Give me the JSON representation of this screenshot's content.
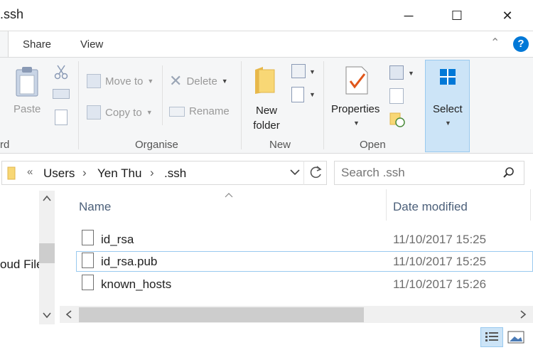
{
  "window": {
    "title": ".ssh",
    "minimize_glyph": "─",
    "maximize_glyph": "☐",
    "close_glyph": "✕"
  },
  "ribbon_tabs": {
    "share": "Share",
    "view": "View"
  },
  "help_glyph": "?",
  "collapse_glyph": "⌃",
  "ribbon": {
    "clipboard": {
      "paste": "Paste",
      "group_label_partial": "rd"
    },
    "organise": {
      "label": "Organise",
      "move_to": "Move to",
      "copy_to": "Copy to",
      "delete": "Delete",
      "rename": "Rename"
    },
    "new": {
      "label": "New",
      "new_folder_line1": "New",
      "new_folder_line2": "folder"
    },
    "open": {
      "label": "Open",
      "properties": "Properties"
    },
    "select": {
      "label": "Select"
    }
  },
  "address": {
    "overflow": "«",
    "crumbs": [
      "Users",
      "Yen Thu",
      ".ssh"
    ],
    "separator": "›"
  },
  "search": {
    "placeholder": "Search .ssh"
  },
  "nav_pane": {
    "partial_item": "oud File"
  },
  "columns": {
    "name": "Name",
    "date_modified": "Date modified"
  },
  "files": [
    {
      "name": "id_rsa",
      "date": "11/10/2017 15:25"
    },
    {
      "name": "id_rsa.pub",
      "date": "11/10/2017 15:25"
    },
    {
      "name": "known_hosts",
      "date": "11/10/2017 15:26"
    }
  ],
  "colors": {
    "accent": "#0078d7",
    "selection_fill": "#cce4f7",
    "selection_border": "#99c9ef"
  }
}
